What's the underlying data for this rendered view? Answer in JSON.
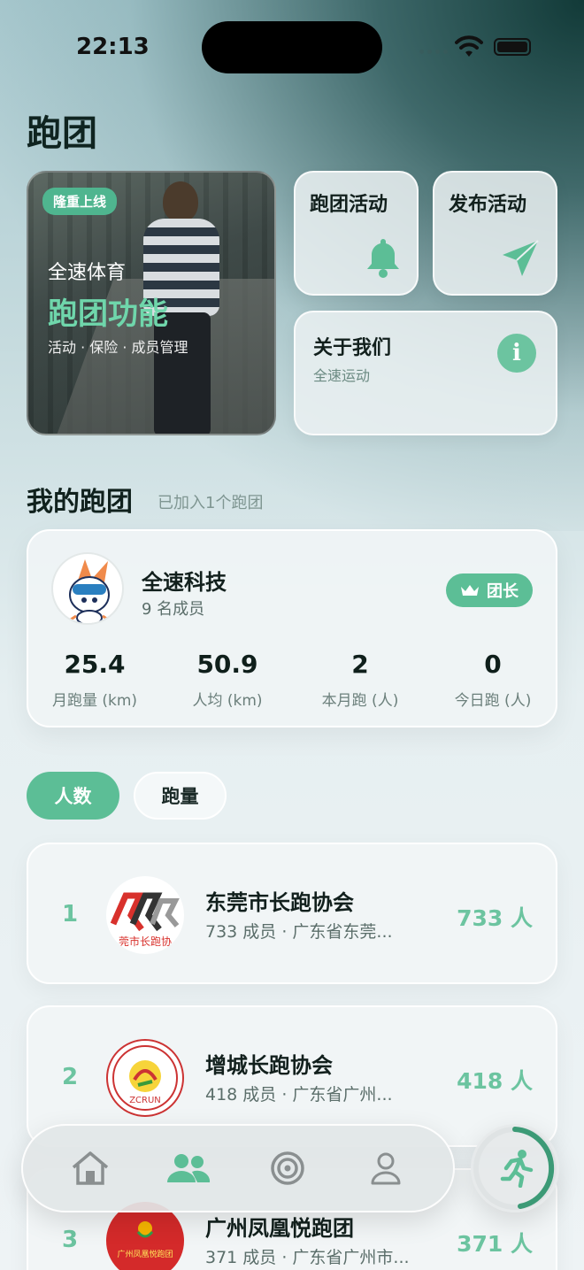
{
  "status": {
    "time": "22:13"
  },
  "page": {
    "title": "跑团"
  },
  "hero": {
    "tag": "隆重上线",
    "line1": "全速体育",
    "line2": "跑团功能",
    "line3": "活动 · 保险 · 成员管理"
  },
  "tiles": {
    "activities": {
      "title": "跑团活动",
      "icon": "bell-icon"
    },
    "publish": {
      "title": "发布活动",
      "icon": "paper-plane-icon"
    },
    "about": {
      "title": "关于我们",
      "subtitle": "全速运动",
      "icon": "info-icon"
    }
  },
  "my_clubs": {
    "title": "我的跑团",
    "subtitle": "已加入1个跑团",
    "club": {
      "name": "全速科技",
      "members": "9 名成员",
      "role": "团长",
      "stats": [
        {
          "value": "25.4",
          "label": "月跑量 (km)"
        },
        {
          "value": "50.9",
          "label": "人均 (km)"
        },
        {
          "value": "2",
          "label": "本月跑 (人)"
        },
        {
          "value": "0",
          "label": "今日跑 (人)"
        }
      ]
    }
  },
  "filters": {
    "active": "人数",
    "inactive": "跑量"
  },
  "ranking": [
    {
      "rank": "1",
      "name": "东莞市长跑协会",
      "sub": "733 成员 · 广东省东莞...",
      "count": "733 人",
      "logo_text": "莞市长跑协"
    },
    {
      "rank": "2",
      "name": "增城长跑协会",
      "sub": "418 成员 · 广东省广州...",
      "count": "418 人",
      "logo_text": "ZCRUN"
    },
    {
      "rank": "3",
      "name": "广州凤凰悦跑团",
      "sub": "371 成员 · 广东省广州市...",
      "count": "371 人",
      "logo_text": "广州凤凰悦跑团"
    }
  ],
  "tabbar": {
    "items": [
      {
        "icon": "home-icon"
      },
      {
        "icon": "people-icon"
      },
      {
        "icon": "target-icon"
      },
      {
        "icon": "person-icon"
      }
    ],
    "run_button_icon": "running-icon",
    "accent": "#5cbe96"
  }
}
